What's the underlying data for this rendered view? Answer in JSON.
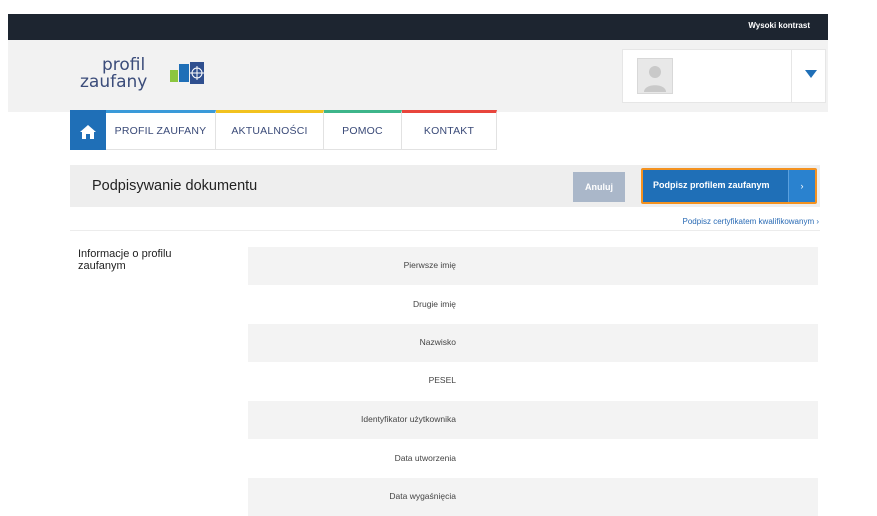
{
  "topbar": {
    "contrast_label": "Wysoki kontrast"
  },
  "logo": {
    "line1": "profil",
    "line2": "zaufany"
  },
  "nav": {
    "items": [
      {
        "label": "PROFIL ZAUFANY",
        "accent": "#3a9ad9"
      },
      {
        "label": "AKTUALNOŚCI",
        "accent": "#f2c21f"
      },
      {
        "label": "POMOC",
        "accent": "#3db58a"
      },
      {
        "label": "KONTAKT",
        "accent": "#e8453c"
      }
    ]
  },
  "main": {
    "title": "Podpisywanie dokumentu",
    "cancel_label": "Anuluj",
    "sign_label": "Podpisz profilem zaufanym",
    "cert_link": "Podpisz certyfikatem kwalifikowanym ›"
  },
  "info": {
    "heading": "Informacje o profilu zaufanym",
    "rows": [
      {
        "label": "Pierwsze imię"
      },
      {
        "label": "Drugie imię"
      },
      {
        "label": "Nazwisko"
      },
      {
        "label": "PESEL"
      },
      {
        "label": "Identyfikator użytkownika"
      },
      {
        "label": "Data utworzenia"
      },
      {
        "label": "Data wygaśnięcia"
      }
    ]
  },
  "colors": {
    "primary": "#1f6fb7",
    "highlight": "#f39221",
    "topbar": "#1d2530"
  },
  "icons": {
    "home": "home-icon",
    "dropdown": "caret-down-icon",
    "avatar": "user-avatar-icon"
  }
}
